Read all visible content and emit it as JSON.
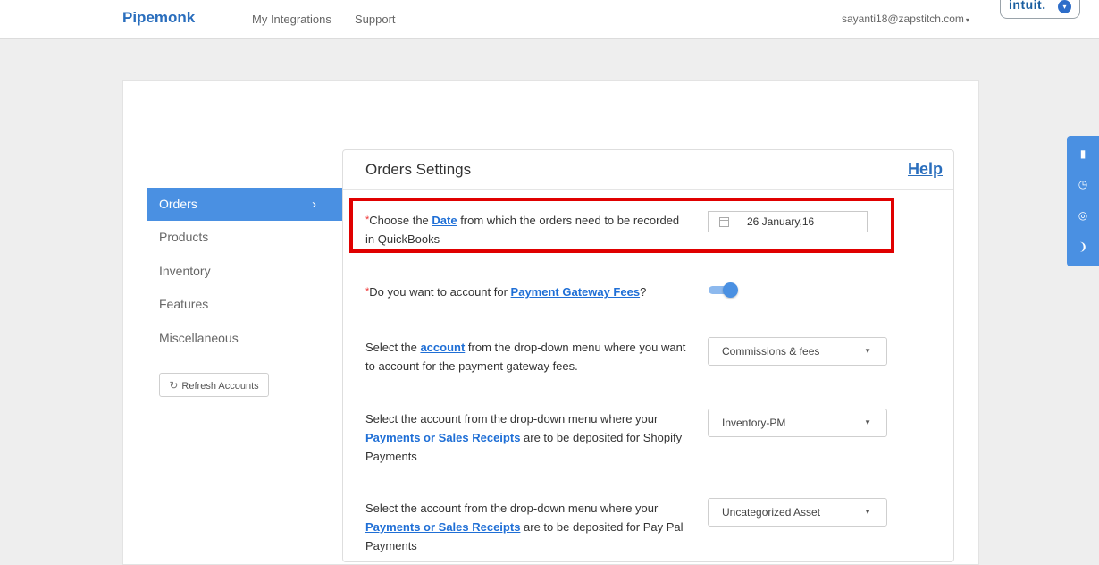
{
  "header": {
    "brand": "Pipemonk",
    "nav": [
      "My Integrations",
      "Support"
    ],
    "user_email": "sayanti18@zapstitch.com",
    "user_caret": "▾",
    "badge_text": "intuit.",
    "badge_drop": "▾"
  },
  "sidebar": {
    "items": [
      {
        "label": "Orders",
        "active": true
      },
      {
        "label": "Products"
      },
      {
        "label": "Inventory"
      },
      {
        "label": "Features"
      },
      {
        "label": "Miscellaneous"
      }
    ],
    "active_chevron": "›",
    "refresh_icon": "↻",
    "refresh_label": "Refresh Accounts"
  },
  "panel": {
    "title": "Orders Settings",
    "help": "Help",
    "required_mark": "*",
    "q1": {
      "a": "Choose the ",
      "link": "Date",
      "b": " from which the orders need to be recorded in QuickBooks"
    },
    "date_value": "26 January,16",
    "q2": {
      "a": "Do you want to account for ",
      "link": "Payment Gateway Fees",
      "b": "?"
    },
    "q3": {
      "a": "Select the ",
      "link": "account",
      "b": " from the drop-down menu where you want to account for the payment gateway fees."
    },
    "select1": "Commissions & fees",
    "q4": {
      "a": "Select the account from the drop-down menu where your ",
      "link": "Payments or Sales Receipts",
      "b": " are to be deposited for Shopify Payments"
    },
    "select2": "Inventory-PM",
    "q5": {
      "a": "Select the account from the drop-down menu where your ",
      "link": "Payments or Sales Receipts",
      "b": " are to be deposited for Pay Pal Payments"
    },
    "select3": "Uncategorized Asset",
    "select_arrow": "▼"
  },
  "widget": {
    "icons": [
      "book-icon",
      "clock-icon",
      "lifebuoy-icon",
      "rss-icon"
    ],
    "glyphs": [
      "▮",
      "◷",
      "◎",
      "❩"
    ]
  },
  "colors": {
    "accent": "#4a90e2",
    "highlight_border": "#e00000",
    "link": "#1f6fd6"
  },
  "toggle_on": true
}
